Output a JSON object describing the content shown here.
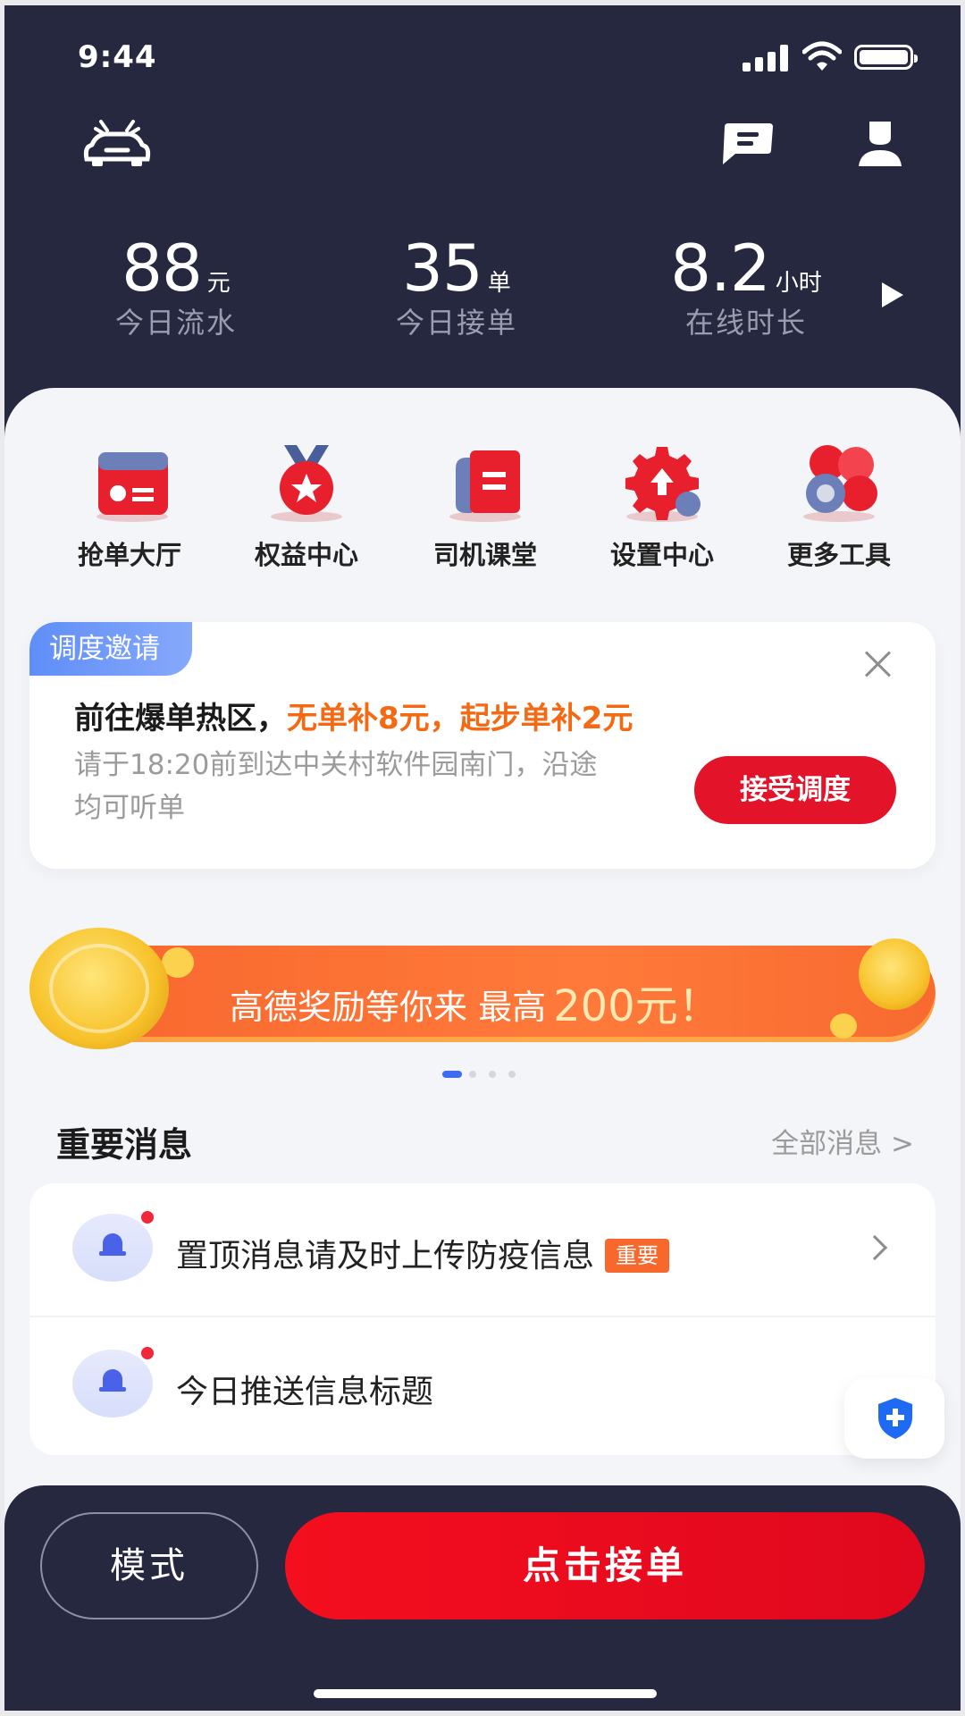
{
  "status_bar": {
    "time": "9:44"
  },
  "stats": [
    {
      "value": "88",
      "unit": "元",
      "label": "今日流水"
    },
    {
      "value": "35",
      "unit": "单",
      "label": "今日接单"
    },
    {
      "value": "8.2",
      "unit": "小时",
      "label": "在线时长"
    }
  ],
  "tools": [
    {
      "label": "抢单大厅",
      "icon": "order-hall-icon"
    },
    {
      "label": "权益中心",
      "icon": "medal-icon"
    },
    {
      "label": "司机课堂",
      "icon": "book-icon"
    },
    {
      "label": "设置中心",
      "icon": "gear-icon"
    },
    {
      "label": "更多工具",
      "icon": "more-tools-icon"
    }
  ],
  "dispatch": {
    "tag": "调度邀请",
    "headline_prefix": "前往爆单热区，",
    "headline_highlight": "无单补8元，起步单补2元",
    "description": "请于18:20前到达中关村软件园南门，沿途均可听单",
    "accept_label": "接受调度"
  },
  "banner": {
    "text": "高德奖励等你来 最高",
    "amount": "200元！",
    "pages": 4,
    "active_page": 1
  },
  "messages": {
    "section_title": "重要消息",
    "all_label": "全部消息 >",
    "items": [
      {
        "text": "置顶消息请及时上传防疫信息",
        "badge": "重要"
      },
      {
        "text": "今日推送信息标题",
        "badge": ""
      }
    ]
  },
  "bottom": {
    "mode_label": "模式",
    "accept_order_label": "点击接单"
  },
  "colors": {
    "primary_red": "#e3132a",
    "dark_bg": "#262840",
    "orange": "#f46a14",
    "accent_blue": "#4a62e8"
  }
}
